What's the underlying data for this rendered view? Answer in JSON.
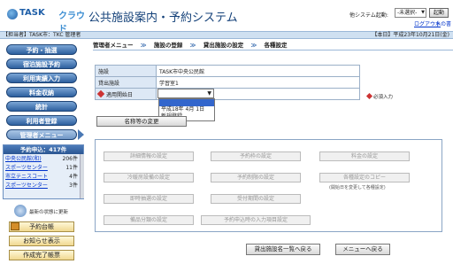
{
  "header": {
    "logo_primary": "TASK",
    "logo_secondary": "クラウド",
    "title": "公共施設案内・予約システム",
    "other_system_label": "他システム起動:",
    "other_system_value": "-未選択-",
    "launch_label": "起動",
    "logout_label": "ログアウト",
    "user_short": "水の書"
  },
  "infobar": {
    "left": "【担当者】TASK市：TKC 管理者",
    "right": "【本日】平成23年10月21日(金)"
  },
  "sidebar": {
    "nav": [
      {
        "label": "予約・抽選"
      },
      {
        "label": "宿泊施設予約"
      },
      {
        "label": "利用実績入力"
      },
      {
        "label": "料金収納"
      },
      {
        "label": "統計"
      },
      {
        "label": "利用者登録"
      },
      {
        "label": "管理者メニュー"
      }
    ],
    "panel_title": "予約申込：417件",
    "panel_rows": [
      {
        "name": "中央公民館(和)",
        "count": "206件"
      },
      {
        "name": "スポーツセンター",
        "count": "11件"
      },
      {
        "name": "市立テニスコート",
        "count": "4件"
      },
      {
        "name": "スポーツセンター",
        "count": "3件"
      }
    ],
    "refresh_label": "最新の状態に更新",
    "sub_buttons": [
      {
        "label": "予約台帳"
      },
      {
        "label": "お知らせ表示"
      },
      {
        "label": "作成完了帳票"
      }
    ]
  },
  "breadcrumb": [
    "管理者メニュー",
    "施設の登録",
    "貸出施設の設定",
    "各種設定"
  ],
  "breadcrumb_sep": "≫",
  "form": {
    "rows": [
      {
        "label": "施設",
        "value": "TASK市中央公民館"
      },
      {
        "label": "貸出施設",
        "value": "学習室1"
      },
      {
        "label": "適用開始日",
        "value": ""
      }
    ],
    "dropdown_options": [
      {
        "label": "",
        "highlighted": true
      },
      {
        "label": "平成18年 4月 1日",
        "highlighted": false
      },
      {
        "label": "新規登録",
        "highlighted": false
      }
    ],
    "required_label": "必須入力"
  },
  "rename_button": "名称等の変更",
  "settings": [
    {
      "label": "詳細情報の設定"
    },
    {
      "label": "予約枠の設定"
    },
    {
      "label": "料金の設定"
    },
    {
      "label": "冷暖房設備の設定"
    },
    {
      "label": "予約制限の設定"
    },
    {
      "label": "各種設定のコピー"
    },
    {
      "label": "即時抽選の設定"
    },
    {
      "label": "受付期間の設定"
    },
    {
      "label": "備品分類の設定"
    },
    {
      "label": "予約申込時の入力項目設定"
    }
  ],
  "copy_note": "(開始日を変更して各種設定)",
  "bottom_buttons": {
    "list_back": "貸出施設名一覧へ戻る",
    "menu_back": "メニューへ戻る"
  }
}
